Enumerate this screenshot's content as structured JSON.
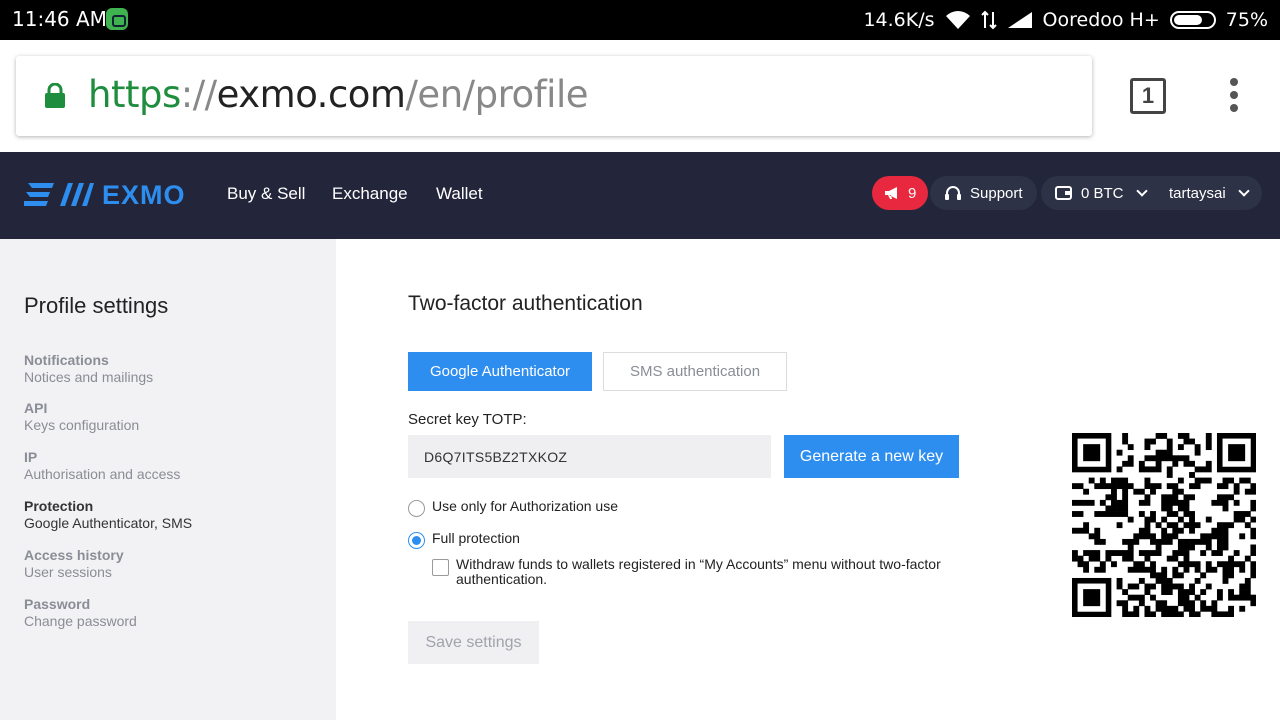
{
  "statusbar": {
    "time": "11:46 AM",
    "speed": "14.6K/s",
    "carrier": "Ooredoo H+",
    "battery": "75%",
    "battery_level": 0.75
  },
  "browser": {
    "url_scheme": "https",
    "url_sep": "://",
    "url_host": "exmo.com",
    "url_path": "/en/profile",
    "tab_count": "1"
  },
  "navbar": {
    "logo_text": "EXMO",
    "links": [
      "Buy & Sell",
      "Exchange",
      "Wallet"
    ],
    "notifications_count": "9",
    "support_label": "Support",
    "balance": "0 BTC",
    "username": "tartaysai",
    "accent_color": "#2e8ef0",
    "badge_color": "#e8283e"
  },
  "sidebar": {
    "title": "Profile settings",
    "items": [
      {
        "title": "Notifications",
        "subtitle": "Notices and mailings"
      },
      {
        "title": "API",
        "subtitle": "Keys configuration"
      },
      {
        "title": "IP",
        "subtitle": "Authorisation and access"
      },
      {
        "title": "Protection",
        "subtitle": "Google Authenticator, SMS"
      },
      {
        "title": "Access history",
        "subtitle": "User sessions"
      },
      {
        "title": "Password",
        "subtitle": "Change password"
      }
    ]
  },
  "main": {
    "title": "Two-factor authentication",
    "tabs": [
      "Google Authenticator",
      "SMS authentication"
    ],
    "secret_label": "Secret key TOTP:",
    "secret_value": "D6Q7ITS5BZ2TXKOZ",
    "generate_label": "Generate a new key",
    "option_auth_only": "Use only for Authorization use",
    "option_full": "Full protection",
    "checkbox_label": "Withdraw funds to wallets registered in “My Accounts” menu without two-factor authentication.",
    "save_label": "Save settings"
  }
}
